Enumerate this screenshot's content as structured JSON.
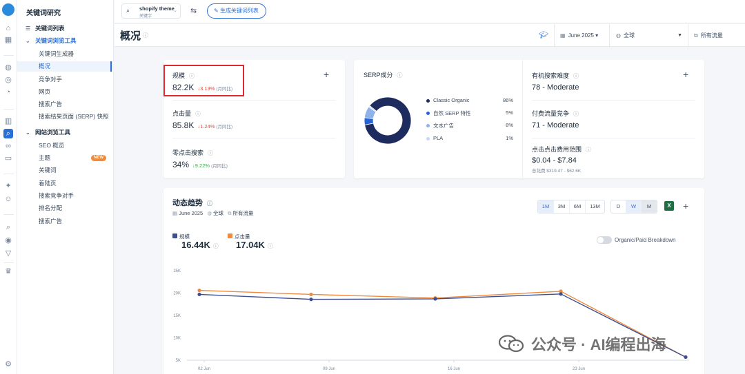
{
  "app": {
    "title": "关键词研究"
  },
  "rail_icons": [
    "home-icon",
    "grid-icon",
    "globe-icon",
    "compass-icon",
    "pie-icon",
    "bar-chart-icon",
    "keyword-icon",
    "link-icon",
    "chat-icon",
    "sparkle-icon",
    "bot-icon",
    "search-icon",
    "target-icon",
    "filter-icon",
    "crown-icon",
    "settings-icon"
  ],
  "nav": {
    "list_label": "关键词列表",
    "browse_tools": "关键词浏览工具",
    "browse_items": [
      "关键词生成器",
      "概况",
      "竞争对手",
      "网页",
      "搜索广告",
      "搜索结果页面 (SERP) 快照"
    ],
    "site_tools": "网站浏览工具",
    "site_items": [
      "SEO 概览",
      "主题",
      "关键词",
      "着陆页",
      "搜索竞争对手",
      "排名分配",
      "搜索广告"
    ],
    "new_badge": "NEW"
  },
  "topbar": {
    "keyword": "shopify theme",
    "keyword_sub": "关键字",
    "generate_button": "生成关键词列表"
  },
  "page": {
    "title": "概况",
    "date": "June 2025",
    "region": "全球",
    "traffic": "所有流量"
  },
  "metrics": {
    "volume": {
      "label": "规模",
      "value": "82.2K",
      "change": "↓3.13%",
      "note": "(月同比)"
    },
    "clicks": {
      "label": "点击量",
      "value": "85.8K",
      "change": "↓1.24%",
      "note": "(月同比)"
    },
    "zero_click": {
      "label": "零点击搜索",
      "value": "34%",
      "change": "↓9.22%",
      "note": "(月同比)"
    }
  },
  "serp": {
    "label": "SERP成分",
    "items": [
      {
        "name": "Classic Organic",
        "pct": "86%",
        "color": "#1d2b5e"
      },
      {
        "name": "自然 SERP 特性",
        "pct": "5%",
        "color": "#2563d8"
      },
      {
        "name": "文本广告",
        "pct": "8%",
        "color": "#8fb2e8"
      },
      {
        "name": "PLA",
        "pct": "1%",
        "color": "#c8d9f3"
      }
    ],
    "donut_values": [
      86,
      5,
      8,
      1
    ]
  },
  "difficulty": {
    "organic_label": "有机搜索难度",
    "organic_value": "78 - Moderate",
    "paid_label": "付费流量竞争",
    "paid_value": "71 - Moderate",
    "cpc_label": "点击点击费用范围",
    "cpc_value": "$0.04 - $7.84",
    "cpc_sub": "总花费 $319.47 - $62.6K"
  },
  "trends": {
    "title": "动态趋势",
    "date": "June 2025",
    "region": "全球",
    "traffic": "所有流量",
    "range_buttons": [
      "1M",
      "3M",
      "6M",
      "13M"
    ],
    "granularity_buttons": [
      "D",
      "W",
      "M"
    ],
    "toggle_label": "Organic/Paid Breakdown",
    "series_labels": {
      "volume": "规模",
      "clicks": "点击量"
    },
    "series_values": {
      "volume": "16.44K",
      "clicks": "17.04K"
    }
  },
  "chart_data": {
    "type": "line",
    "x_ticks": [
      "02 Jun",
      "09 Jun",
      "16 Jun",
      "23 Jun"
    ],
    "x": [
      "2025-06-02",
      "2025-06-09",
      "2025-06-16",
      "2025-06-23",
      "2025-06-30"
    ],
    "ylim": [
      5000,
      25000
    ],
    "y_ticks": [
      "5K",
      "10K",
      "15K",
      "20K",
      "25K"
    ],
    "y_tick_values": [
      5000,
      10000,
      15000,
      20000,
      25000
    ],
    "series": [
      {
        "name": "规模",
        "color": "#3d4f8f",
        "values": [
          19700,
          18600,
          18700,
          19800,
          5700
        ]
      },
      {
        "name": "点击量",
        "color": "#f08a3c",
        "values": [
          20600,
          19700,
          18900,
          20400,
          5700
        ]
      }
    ],
    "grid": false,
    "legend": "top-left"
  },
  "watermark": "公众号 · AI编程出海"
}
